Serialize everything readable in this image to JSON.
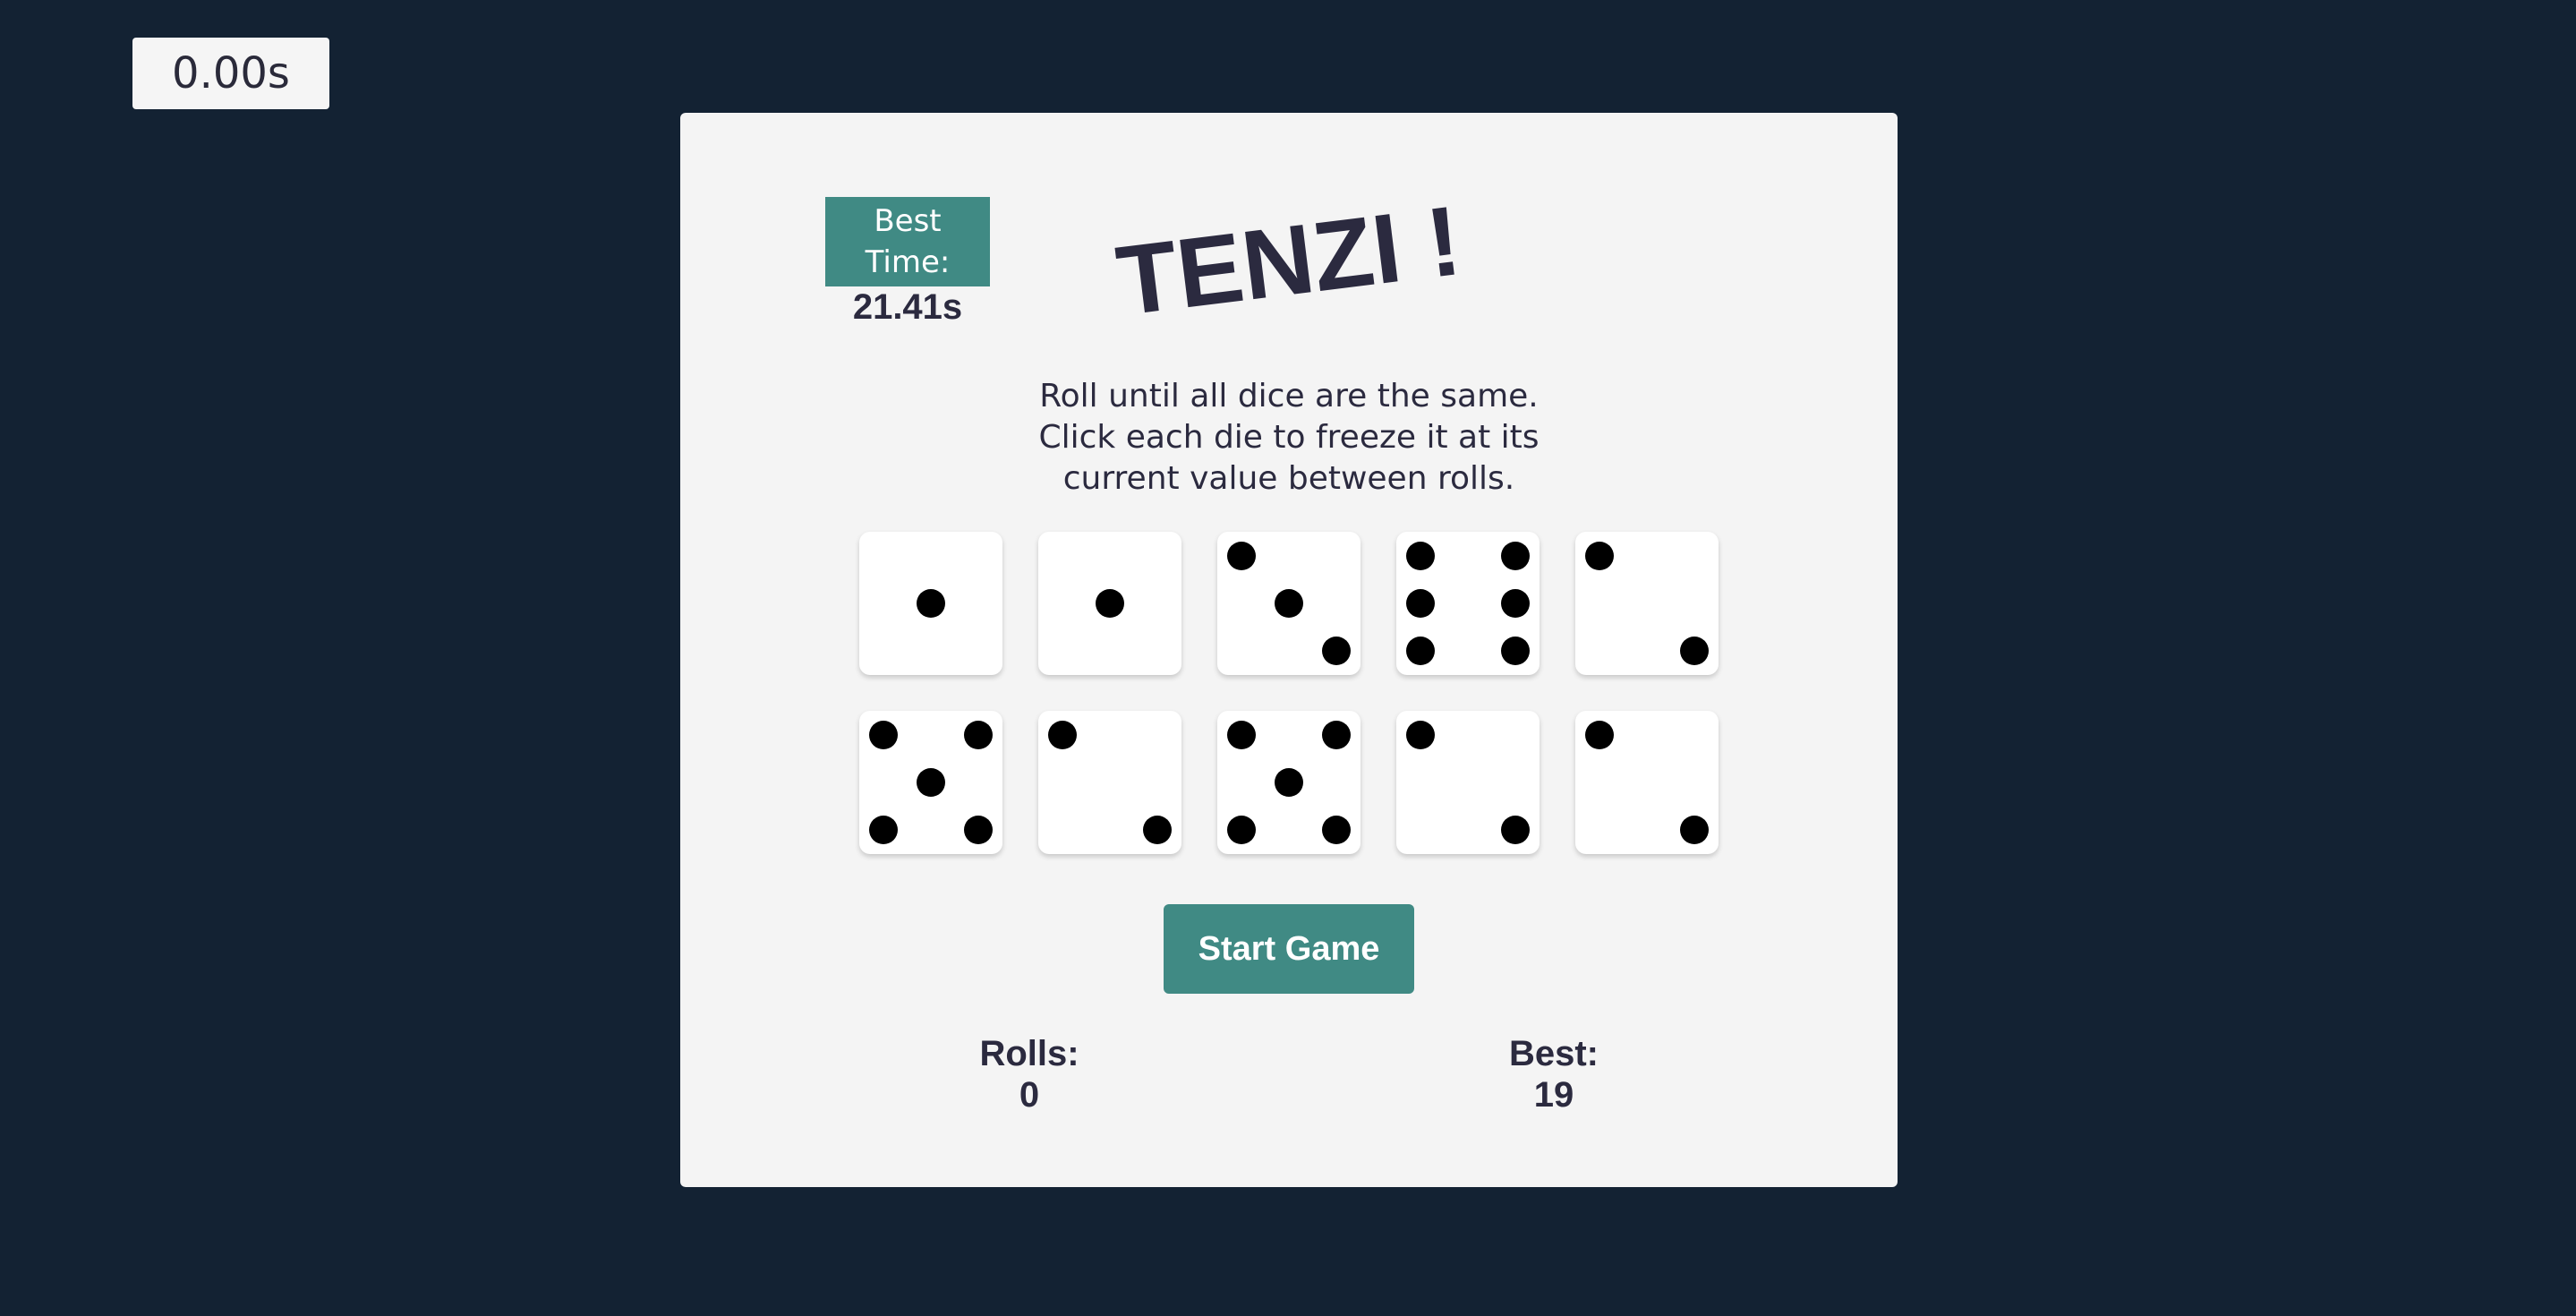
{
  "timer": {
    "value": "0.00s"
  },
  "best_time": {
    "label": "Best Time:",
    "value": "21.41s"
  },
  "title": "TENZI !",
  "instructions": [
    "Roll until all dice are the same.",
    "Click each die to freeze it at its",
    "current value between rolls."
  ],
  "dice": [
    1,
    1,
    3,
    6,
    2,
    5,
    2,
    5,
    2,
    2
  ],
  "start_button": {
    "label": "Start Game"
  },
  "stats": {
    "rolls": {
      "label": "Rolls:",
      "value": "0"
    },
    "best": {
      "label": "Best:",
      "value": "19"
    }
  },
  "colors": {
    "background": "#132233",
    "card": "#f4f4f4",
    "accent": "#408a84",
    "text": "#2b2a3f",
    "die": "#ffffff",
    "pip": "#000000"
  }
}
